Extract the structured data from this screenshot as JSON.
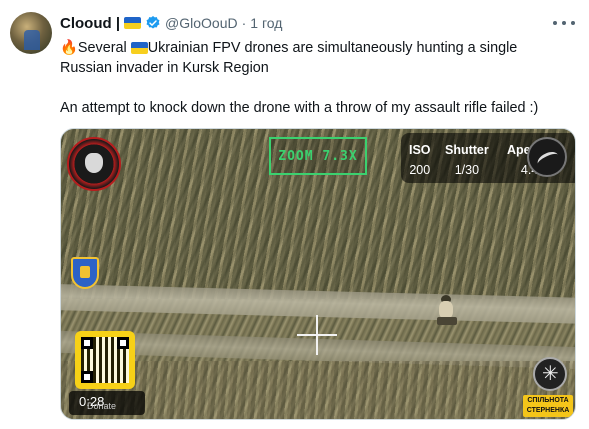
{
  "tweet": {
    "author_name": "Clooud |",
    "handle": "@GloOouD",
    "separator": "·",
    "time": "1 год",
    "line1_prefix": "🔥Several ",
    "line1_suffix": "Ukrainian FPV drones are simultaneously hunting a single",
    "line2": "Russian invader in Kursk Region",
    "line3": "An attempt to knock down the drone with a throw of my assault rifle failed :)"
  },
  "video": {
    "zoom_label": "ZOOM 7.3X",
    "camera": {
      "iso_label": "ISO",
      "iso_value": "200",
      "shutter_label": "Shutter",
      "shutter_value": "1/30",
      "aperture_label": "Apertur",
      "aperture_value": "4.4"
    },
    "duration": "0:28",
    "qr_caption": "Donate",
    "watermark_line1": "СПІЛЬНОТА",
    "watermark_line2": "СТЕРНЕНКА"
  },
  "icons": {
    "flag": "ukraine-flag-icon",
    "verified": "verified-badge-icon",
    "more": "more-options-icon"
  },
  "colors": {
    "accent_blue": "#1d9bf0",
    "zoom_green": "#3bd16f",
    "flag_blue": "#1f64c8",
    "flag_yellow": "#f7cf1e"
  }
}
